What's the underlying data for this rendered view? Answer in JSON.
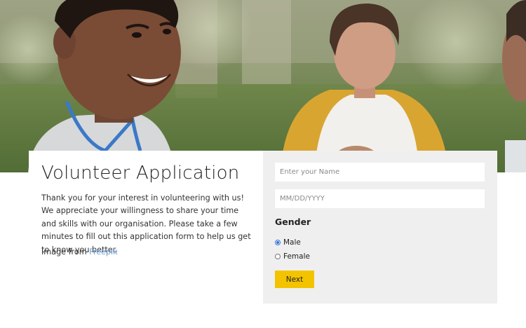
{
  "hero": {
    "image_subject": "smiling-volunteers-photo"
  },
  "intro_card": {
    "title": "Volunteer Application",
    "description": "Thank you for your interest in volunteering with us! We appreciate your willingness to share your time and skills with our organisation. Please take a few minutes to fill out this application form to help us get to know you better.",
    "credit_prefix": "Image from",
    "credit_link": "Freepik"
  },
  "form": {
    "name_field": {
      "value": "",
      "placeholder": "Enter your Name"
    },
    "date_field": {
      "value": "",
      "placeholder": "MM/DD/YYYY"
    },
    "gender_label": "Gender",
    "gender_options": [
      {
        "label": "Male",
        "selected": true
      },
      {
        "label": "Female",
        "selected": false
      }
    ],
    "next_label": "Next"
  },
  "colors": {
    "button_accent": "#f3c300",
    "panel_background": "#efefef",
    "link": "#6c9bd2",
    "radio_selected": "#2f6fd6"
  }
}
